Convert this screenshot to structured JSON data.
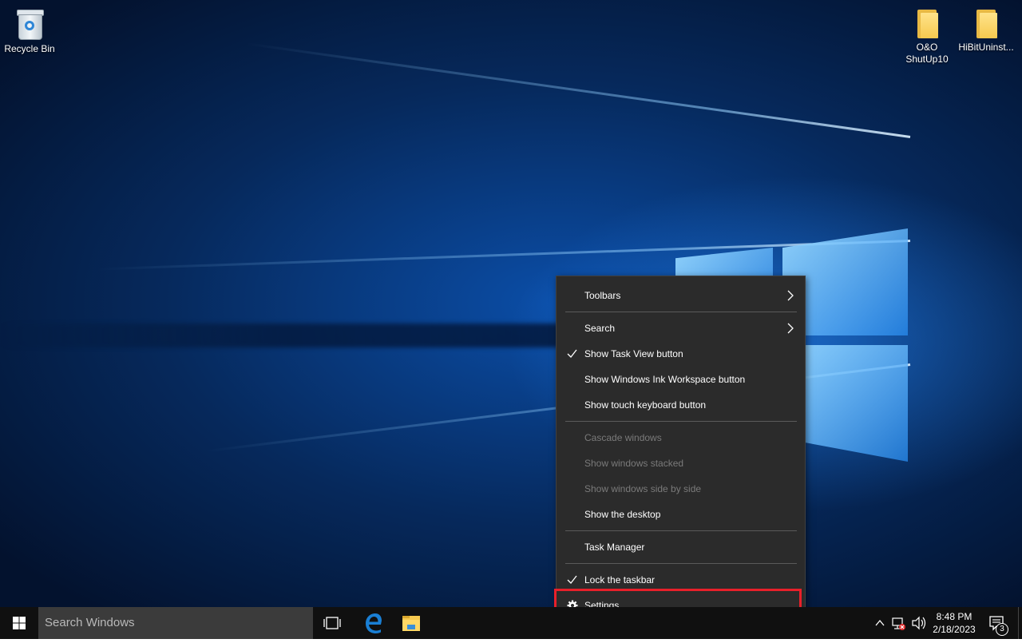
{
  "desktop": {
    "icons": [
      {
        "label": "Recycle Bin",
        "icon": "recycle-bin-icon"
      },
      {
        "label": "O&O ShutUp10",
        "icon": "folder-icon"
      },
      {
        "label": "HiBitUninst...",
        "icon": "folder-icon"
      }
    ]
  },
  "context_menu": {
    "items": {
      "toolbars": "Toolbars",
      "search": "Search",
      "show_task_view": "Show Task View button",
      "show_ink_workspace": "Show Windows Ink Workspace button",
      "show_touch_keyboard": "Show touch keyboard button",
      "cascade": "Cascade windows",
      "stacked": "Show windows stacked",
      "side_by_side": "Show windows side by side",
      "show_desktop": "Show the desktop",
      "task_manager": "Task Manager",
      "lock_taskbar": "Lock the taskbar",
      "settings": "Settings"
    },
    "checked": [
      "Show Task View button",
      "Lock the taskbar"
    ],
    "disabled": [
      "Cascade windows",
      "Show windows stacked",
      "Show windows side by side"
    ],
    "highlighted": "Settings",
    "highlight_color": "#e8202a"
  },
  "taskbar": {
    "search_placeholder": "Search Windows",
    "pinned": [
      "task-view-icon",
      "edge-icon",
      "file-explorer-icon"
    ],
    "clock": {
      "time": "8:48 PM",
      "date": "2/18/2023"
    },
    "notification_count": "3"
  },
  "colors": {
    "menu_bg": "#2b2b2b",
    "taskbar_bg": "#101010",
    "search_bg": "#3b3b3b",
    "edge_blue": "#1a7fd4",
    "folder_yellow": "#f6c94f"
  }
}
